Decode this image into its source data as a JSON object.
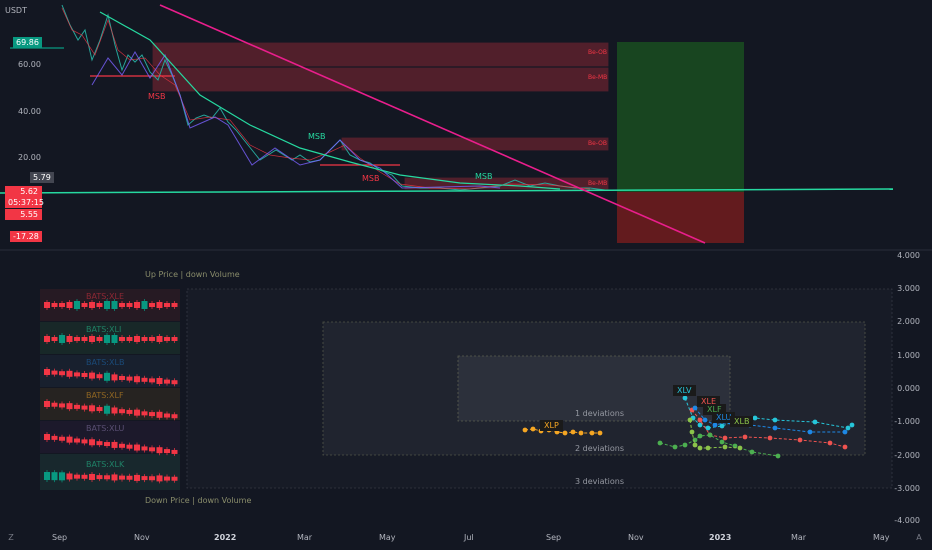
{
  "top_chart": {
    "currency": "USDT",
    "y_ticks": [
      "60.00",
      "40.00",
      "20.00"
    ],
    "price_badges": [
      {
        "text": "69.86",
        "color": "#089981"
      },
      {
        "text": "5.79",
        "color": "#434651"
      },
      {
        "text": "5.62",
        "color": "#f23645"
      },
      {
        "text": "05:37:15",
        "color": "#f23645"
      },
      {
        "text": "5.55",
        "color": "#f23645"
      },
      {
        "text": "-17.28",
        "color": "#f23645"
      }
    ],
    "zone_labels": [
      "Be-OB",
      "Be-MB",
      "Be-MB",
      "Be-OB",
      "Be-MB"
    ],
    "msb_labels": [
      "MSB",
      "MSB",
      "MSB",
      "MSB",
      "MSB"
    ]
  },
  "bottom_chart": {
    "y_ticks": [
      "4.000",
      "3.000",
      "2.000",
      "1.000",
      "0.000",
      "-1.000",
      "-2.000",
      "-3.000",
      "-4.000"
    ],
    "quadrant_top": "Up Price | down Volume",
    "quadrant_bottom": "Down Price | down Volume",
    "deviation_labels": [
      "1 deviations",
      "2 deviations",
      "3 deviations"
    ],
    "panel_labels": [
      "BATS:XLE",
      "BATS:XLI",
      "BATS:XLB",
      "BATS:XLF",
      "BATS:XLU",
      "BATS:XLK"
    ],
    "point_labels": [
      "XLP",
      "XLV",
      "XLE",
      "XLF",
      "XLU",
      "XLB"
    ]
  },
  "x_axis": {
    "ticks": [
      "Sep",
      "Nov",
      "2022",
      "Mar",
      "May",
      "Jul",
      "Sep",
      "Nov",
      "2023",
      "Mar",
      "May"
    ],
    "bold_ticks": [
      "2022",
      "2023"
    ]
  },
  "corner_icons": {
    "left": "Z",
    "right": "A"
  },
  "colors": {
    "up": "#089981",
    "down": "#f23645",
    "trend_pink": "#e91e8c",
    "trend_green": "#26d9a0",
    "zone_fill": "#f2364540",
    "long_green": "#1b5e20",
    "long_red": "#7f1d1d",
    "xlp": "#f5a623",
    "xlv": "#26c6da",
    "xle": "#ef5350",
    "xlf": "#4caf50",
    "xlu": "#1e88e5",
    "xlb": "#8bc34a"
  }
}
